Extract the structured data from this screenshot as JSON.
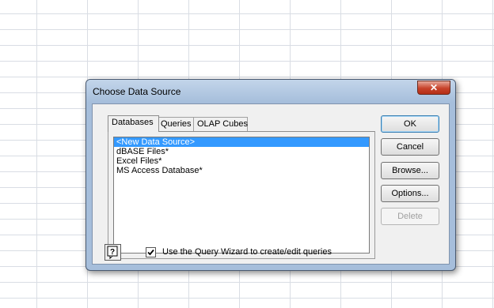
{
  "dialog": {
    "title": "Choose Data Source",
    "close_label": "✕"
  },
  "tabs": [
    {
      "label": "Databases",
      "active": true
    },
    {
      "label": "Queries",
      "active": false
    },
    {
      "label": "OLAP Cubes",
      "active": false
    }
  ],
  "list": {
    "items": [
      "<New Data Source>",
      "dBASE Files*",
      "Excel Files*",
      "MS Access Database*"
    ],
    "selected_index": 0
  },
  "buttons": {
    "ok": "OK",
    "cancel": "Cancel",
    "browse": "Browse...",
    "options": "Options...",
    "delete": "Delete"
  },
  "query_wizard": {
    "label": "Use the Query Wizard to create/edit queries",
    "checked": true
  },
  "icons": {
    "help": "help-icon",
    "close": "close-icon",
    "check": "checkmark-icon"
  }
}
